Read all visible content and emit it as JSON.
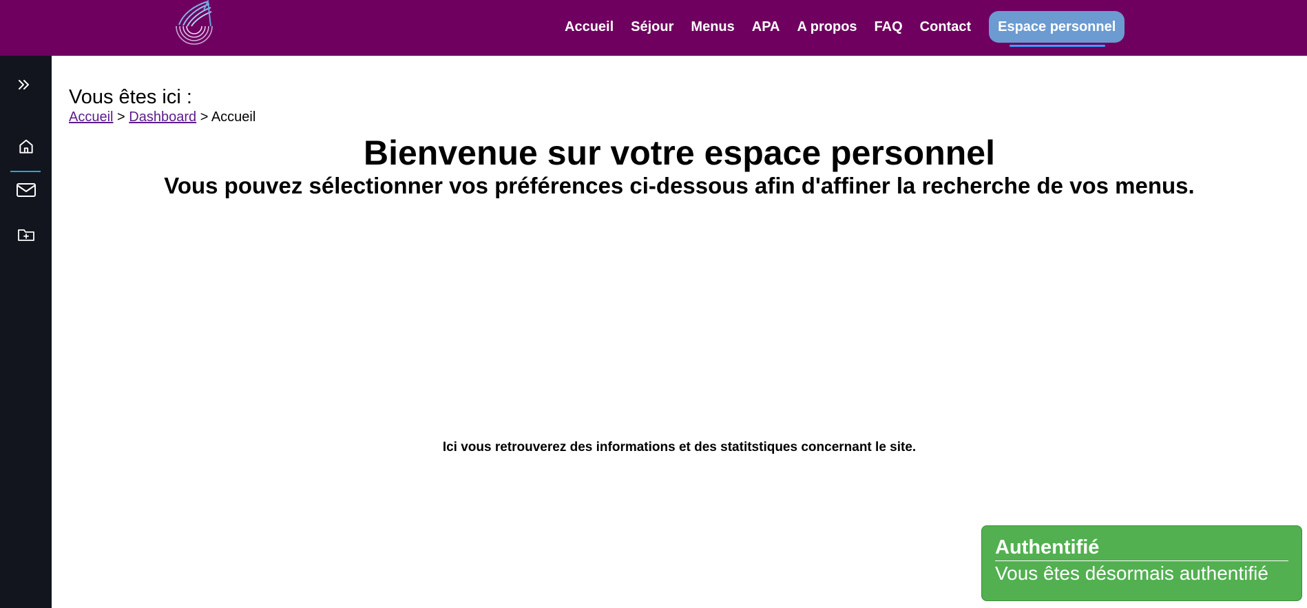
{
  "header": {
    "logo_icon": "wing-logo-icon",
    "nav": [
      {
        "label": "Accueil"
      },
      {
        "label": "Séjour"
      },
      {
        "label": "Menus"
      },
      {
        "label": "APA"
      },
      {
        "label": "A propos"
      },
      {
        "label": "FAQ"
      },
      {
        "label": "Contact"
      }
    ],
    "cta_label": "Espace personnel",
    "colors": {
      "background": "#6f0060",
      "cta": "#6b9bd1"
    }
  },
  "sidebar": {
    "toggle_icon": "double-chevron-right-icon",
    "items": [
      {
        "icon": "home-icon",
        "active": true
      },
      {
        "icon": "mail-icon",
        "active": false
      },
      {
        "icon": "folder-plus-icon",
        "active": false
      }
    ],
    "colors": {
      "background": "#12151d",
      "active_line": "#1fa9d6"
    }
  },
  "main": {
    "location_label": "Vous êtes ici :",
    "breadcrumb": [
      {
        "label": "Accueil",
        "link": true
      },
      {
        "label": "Dashboard",
        "link": true
      },
      {
        "label": "Accueil",
        "link": false
      }
    ],
    "breadcrumb_separator": ">",
    "title": "Bienvenue sur votre espace personnel",
    "subtitle": "Vous pouvez sélectionner vos préférences ci-dessous afin d'affiner la recherche de vos menus.",
    "info_text": "Ici vous retrouverez des informations et des statitstiques concernant le site."
  },
  "toast": {
    "title": "Authentifié",
    "message": "Vous êtes désormais authentifié",
    "color": "#52b050"
  }
}
